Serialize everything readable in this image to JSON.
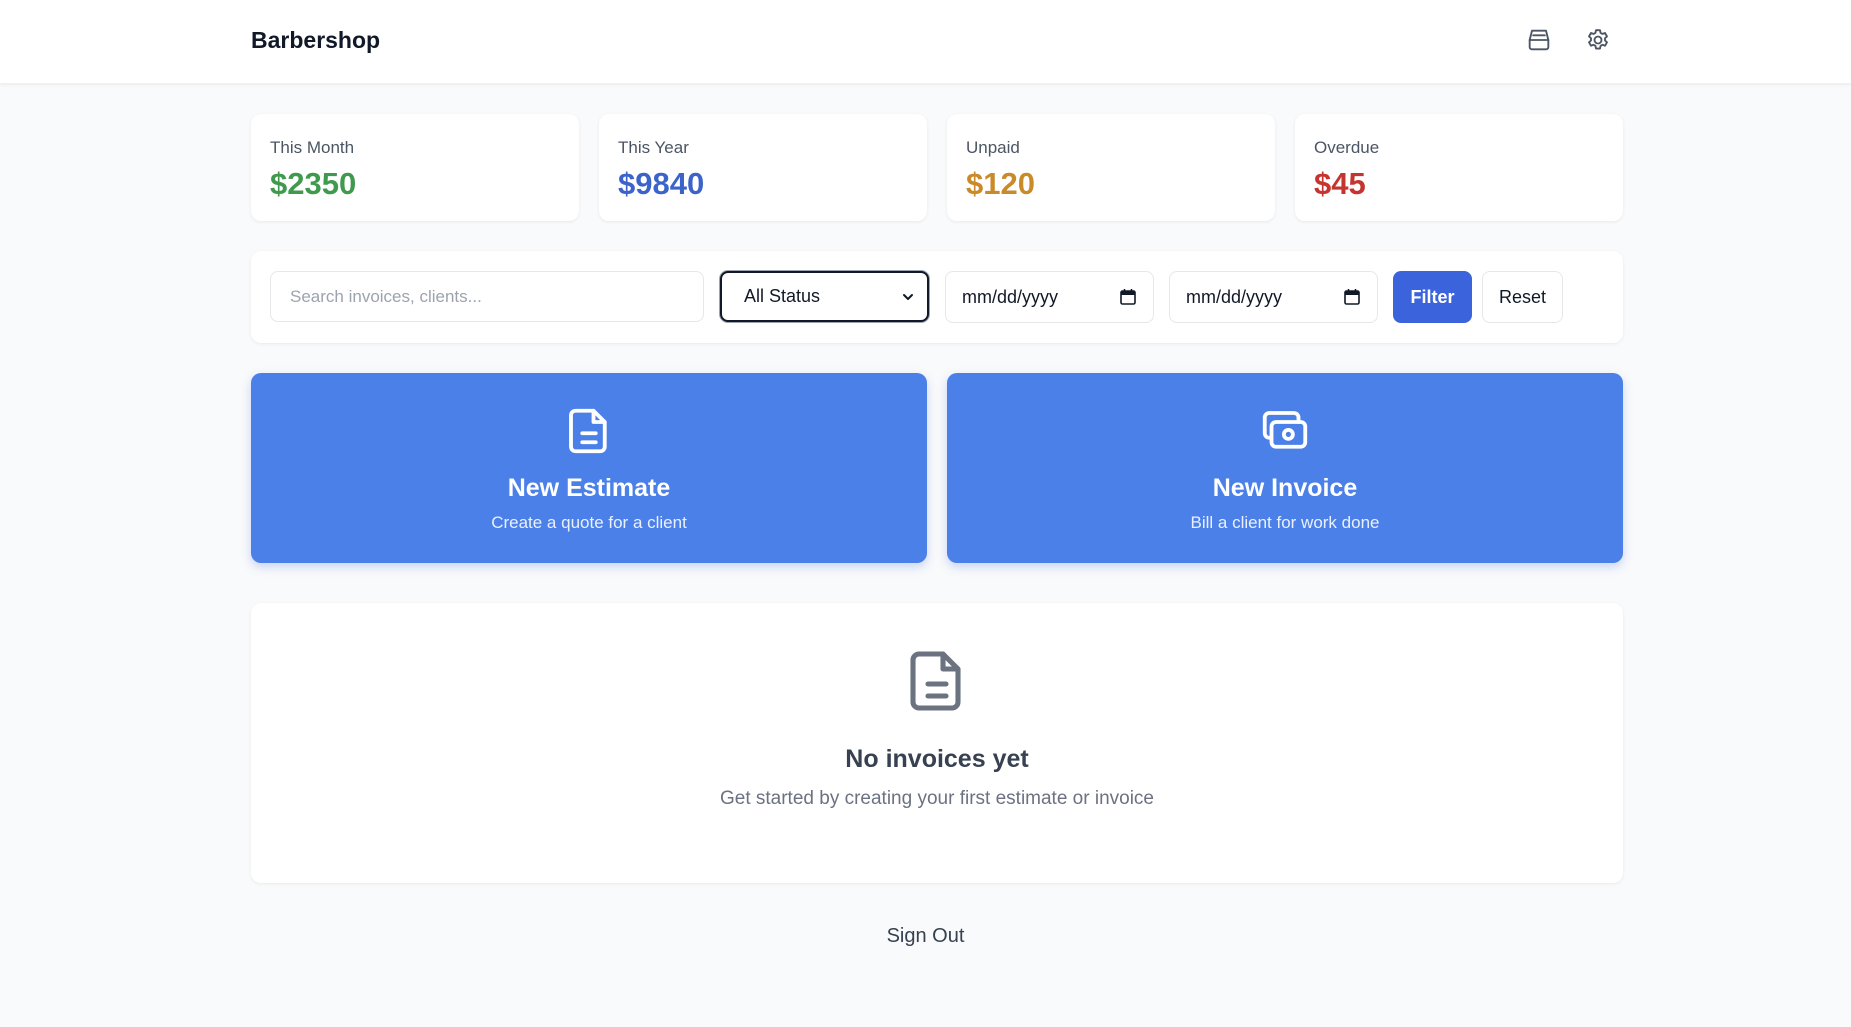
{
  "header": {
    "brand": "Barbershop",
    "icons": {
      "inbox": "inbox-icon",
      "settings": "gear-icon"
    }
  },
  "stats": [
    {
      "label": "This Month",
      "value": "$2350",
      "color": "#3f9a4d"
    },
    {
      "label": "This Year",
      "value": "$9840",
      "color": "#3b63c9"
    },
    {
      "label": "Unpaid",
      "value": "$120",
      "color": "#c98a2a"
    },
    {
      "label": "Overdue",
      "value": "$45",
      "color": "#c5352f"
    }
  ],
  "filters": {
    "search_placeholder": "Search invoices, clients...",
    "status_selected": "All Status",
    "date_from_placeholder": "mm/dd/yyyy",
    "date_to_placeholder": "mm/dd/yyyy",
    "filter_label": "Filter",
    "reset_label": "Reset"
  },
  "actions": [
    {
      "title": "New Estimate",
      "subtitle": "Create a quote for a client",
      "icon": "document-icon"
    },
    {
      "title": "New Invoice",
      "subtitle": "Bill a client for work done",
      "icon": "cash-icon"
    }
  ],
  "empty_state": {
    "title": "No invoices yet",
    "subtitle": "Get started by creating your first estimate or invoice",
    "icon": "document-icon"
  },
  "footer": {
    "signout_label": "Sign Out"
  },
  "colors": {
    "accent": "#3b63db",
    "action_card": "#4b80e8",
    "background": "#f9fafb"
  }
}
